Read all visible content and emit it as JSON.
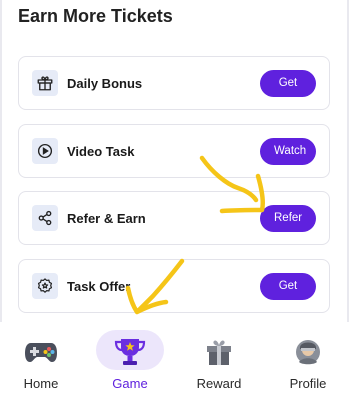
{
  "title": "Earn More Tickets",
  "tasks": [
    {
      "label": "Daily Bonus",
      "button": "Get",
      "icon": "gift-icon"
    },
    {
      "label": "Video Task",
      "button": "Watch",
      "icon": "play-circle-icon"
    },
    {
      "label": "Refer & Earn",
      "button": "Refer",
      "icon": "share-icon"
    },
    {
      "label": "Task Offer",
      "button": "Get",
      "icon": "badge-star-icon"
    }
  ],
  "nav": {
    "items": [
      {
        "label": "Home",
        "icon": "gamepad-icon"
      },
      {
        "label": "Game",
        "icon": "trophy-icon"
      },
      {
        "label": "Reward",
        "icon": "gift-box-icon"
      },
      {
        "label": "Profile",
        "icon": "profile-avatar-icon"
      }
    ],
    "active": "Game"
  },
  "colors": {
    "accent": "#5f21de",
    "icon_bg": "#e6ebf7",
    "active_pill": "#ece6fb",
    "annotation": "#f5c518"
  }
}
